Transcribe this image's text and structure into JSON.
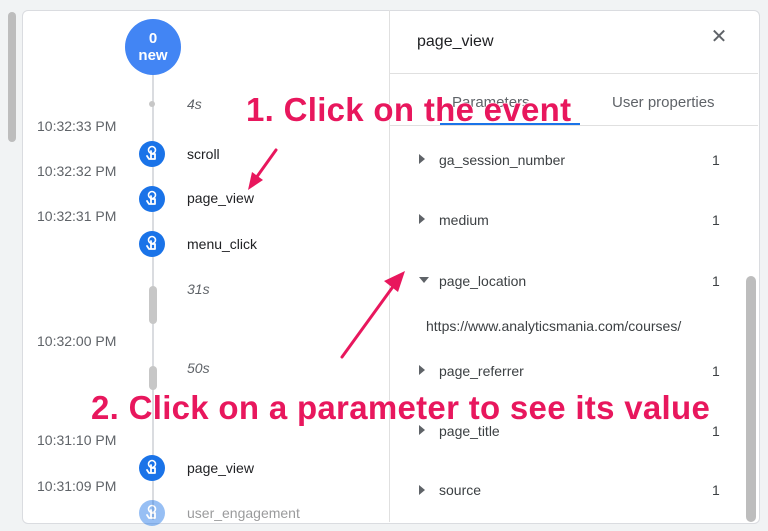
{
  "timeline": {
    "new_count": "0",
    "new_label": "new",
    "gaps": [
      "4s",
      "31s",
      "50s"
    ],
    "timestamps": [
      "10:32:33 PM",
      "10:32:32 PM",
      "10:32:31 PM",
      "10:32:00 PM",
      "10:31:10 PM",
      "10:31:09 PM"
    ],
    "events": [
      "scroll",
      "page_view",
      "menu_click",
      "page_view",
      "user_engagement"
    ]
  },
  "details": {
    "title": "page_view",
    "close_icon": "close-icon",
    "tabs": [
      "Parameters",
      "User properties"
    ],
    "parameters": [
      {
        "name": "ga_session_number",
        "count": "1"
      },
      {
        "name": "medium",
        "count": "1"
      },
      {
        "name": "page_location",
        "count": "1",
        "value": "https://www.analyticsmania.com/courses/"
      },
      {
        "name": "page_referrer",
        "count": "1"
      },
      {
        "name": "page_title",
        "count": "1"
      },
      {
        "name": "source",
        "count": "1"
      }
    ]
  },
  "annotations": {
    "step1": "1. Click on the event",
    "step2": "2. Click on a parameter to see its value",
    "color": "#e8175d"
  },
  "colors": {
    "accent": "#1a73e8",
    "badge": "#4285f4"
  }
}
